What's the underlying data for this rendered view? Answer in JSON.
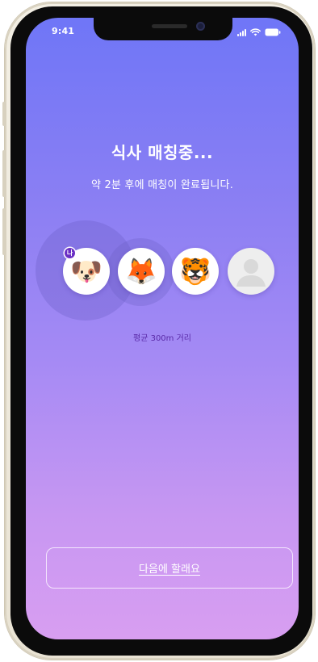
{
  "status_bar": {
    "time": "9:41"
  },
  "matching": {
    "title": "식사 매칭중...",
    "subtitle": "약 2분 후에 매칭이 완료됩니다.",
    "me_badge": "나",
    "distance": "평균 300m 거리"
  },
  "avatars": [
    {
      "emoji": "🐶",
      "name": "dog"
    },
    {
      "emoji": "🦊",
      "name": "fox"
    },
    {
      "emoji": "🐯",
      "name": "tiger"
    },
    {
      "emoji": "",
      "name": "empty-slot"
    }
  ],
  "actions": {
    "later_label": "다음에 할래요"
  },
  "colors": {
    "gradient_top": "#6f76f7",
    "gradient_bottom": "#d89ef1",
    "distance_text": "#5a2aa8",
    "badge": "#6a2fc4"
  }
}
